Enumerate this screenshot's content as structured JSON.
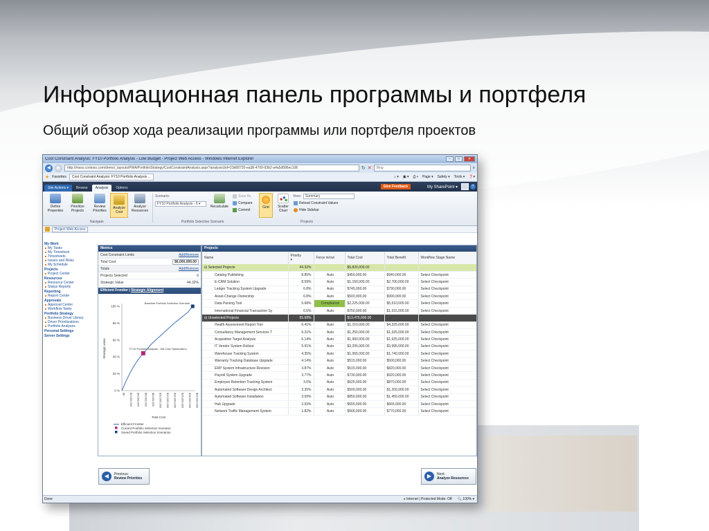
{
  "slide": {
    "title": "Информационная панель программы  и портфеля",
    "subtitle": "Общий обзор хода реализации программы или портфеля проектов"
  },
  "browser": {
    "title": "Cost Constraint Analysis: FY10 Portfolio Analysis - Low Budget - Project Web Access - Windows Internet Explorer",
    "url": "http://msss.contoso.com/demo/_layouts/PWA/PortfolioStrategy/CostConstraintAnalysis.aspx?analysisUid=23d68720-ea38-4709-93b2-a4a5d586ec106",
    "search_placeholder": "Bing",
    "favorites_label": "Favorites",
    "fav_tab": "Cost Constraint Analysis: FY10 Portfolio Analysis ...",
    "tool_page": "Page ▾",
    "tool_safety": "Safety ▾",
    "tool_tools": "Tools ▾",
    "status_left": "Done",
    "status_zone": "Internet | Protected Mode: Off",
    "zoom": "100%"
  },
  "ribbon": {
    "tabs": [
      "Site Actions ▾",
      "Browse",
      "Analysis",
      "Options"
    ],
    "give_feedback": "Give Feedback",
    "user": "My SharePoint ▾",
    "buttons": {
      "define": "Define Properties",
      "prioritize": "Prioritize Projects",
      "review": "Review Priorities",
      "analyze_cost": "Analyze Cost",
      "analyze_res": "Analyze Resources",
      "recalculate": "Recalculate",
      "save_as": "Save As",
      "compare": "Compare",
      "commit": "Commit",
      "grid": "Grid",
      "scatter": "Scatter Chart",
      "reload": "Reload Constraint Values",
      "hide_sidebar": "Hide Sidebar"
    },
    "scenario_label": "Scenario:",
    "scenario_value": "FY10 Portfolio Analysis - 6 ▾",
    "view_label": "View:",
    "view_value": "Summary",
    "groups": {
      "navigate": "Navigate",
      "scenario": "Portfolio Selection Scenario",
      "projects": "Projects"
    }
  },
  "breadcrumb": {
    "link": "Project Web Access"
  },
  "leftnav": [
    {
      "h": "My Work"
    },
    {
      "i": "My Tasks"
    },
    {
      "i": "My Timesheet"
    },
    {
      "i": "Timesheets"
    },
    {
      "i": "Issues and Risks"
    },
    {
      "i": "My Schedule"
    },
    {
      "h": "Projects"
    },
    {
      "i": "Project Center"
    },
    {
      "h": "Resources"
    },
    {
      "i": "Resource Center"
    },
    {
      "i": "Status Reports"
    },
    {
      "h": "Reporting"
    },
    {
      "i": "Report Center"
    },
    {
      "h": "Approvals"
    },
    {
      "i": "Approval Center"
    },
    {
      "i": "Workflow Tasks"
    },
    {
      "h": "Portfolio Strategy"
    },
    {
      "i": "Business Driver Library"
    },
    {
      "i": "Driver Prioritizations"
    },
    {
      "i": "Portfolio Analyses"
    },
    {
      "h": "Personal Settings"
    },
    {
      "h": "Server Settings"
    }
  ],
  "metrics": {
    "header": "Metrics",
    "cost_limits": "Cost Constraint Limits",
    "add_remove": "Add/Remove",
    "total_cost_label": "Total Cost",
    "total_cost_value": "$6,000,000.00",
    "totals": "Totals",
    "projects_selected_label": "Projects Selected",
    "projects_selected_value": "6",
    "strategic_value_label": "Strategic Value",
    "strategic_value_value": "44.32%",
    "ef_title": "Efficient Frontier",
    "ef_link": "Strategic Alignment"
  },
  "chart_data": {
    "type": "line",
    "ylabel": "Strategic value",
    "xlabel": "Total Cost",
    "y_ticks": [
      "100 %",
      "80 %",
      "60 %",
      "40 %",
      "20 %",
      "0 %"
    ],
    "x_ticks": [
      "$0",
      "$2,000,000",
      "$4,000,000",
      "$6,000,000",
      "$8,000,000",
      "$10,000,000",
      "$12,000,000",
      "$14,000,000",
      "$16,000,000",
      "$18,000,000",
      "$20,000,000"
    ],
    "annotations": {
      "baseline": "Baseline Portfolio Selection Scenario",
      "current": "FY10 Portfolio Analysis - 6M Cost Optimization"
    },
    "series": [
      {
        "name": "Efficient Frontier",
        "color": "#3f6fb4",
        "x": [
          0,
          1000000,
          2000000,
          3000000,
          4000000,
          5000000,
          6000000,
          8000000,
          10000000,
          12000000,
          14000000,
          16000000,
          18000000,
          19300000
        ],
        "y": [
          0,
          10,
          19,
          27,
          34,
          40,
          45,
          55,
          63,
          71,
          79,
          86,
          93,
          100
        ]
      },
      {
        "name": "Current Portfolio Selection Scenario",
        "color": "#b0287a",
        "x": [
          5820000
        ],
        "y": [
          44.32
        ]
      },
      {
        "name": "Saved Portfolio Selection Scenarios",
        "color": "#1d3f7a",
        "x": [
          19300000
        ],
        "y": [
          100
        ]
      }
    ],
    "ylim": [
      0,
      100
    ],
    "xlim": [
      0,
      20000000
    ]
  },
  "projects": {
    "header": "Projects",
    "columns": [
      "Name",
      "Priority",
      "Force in/out",
      "Total Cost",
      "Total Benefit",
      "Workflow Stage Name"
    ],
    "selected": {
      "label": "Selected Projects",
      "priority": "44.32%",
      "cost": "$5,820,000.00"
    },
    "selected_rows": [
      [
        "Catalog Publishing",
        "8.85%",
        "Auto",
        "$450,000.00",
        "$940,000.00",
        "Select Checkpoint"
      ],
      [
        "E-CRM Solution",
        "8.59%",
        "Auto",
        "$1,150,000.00",
        "$2,700,000.00",
        "Select Checkpoint"
      ],
      [
        "Ledger Tracking System Upgrade",
        "6.8%",
        "Auto",
        "$745,000.00",
        "$790,000.00",
        "Select Checkpoint"
      ],
      [
        "Asset-Change Ownership",
        "6.8%",
        "Auto",
        "$500,000.00",
        "$990,000.00",
        "Select Checkpoint"
      ],
      [
        "Data Parsing Tool",
        "6.68%",
        "Compliance",
        "$2,225,000.00",
        "$5,510,000.00",
        "Select Checkpoint"
      ],
      [
        "International Financial Transaction Sy",
        "6.6%",
        "Auto",
        "$750,000.00",
        "$1,315,000.00",
        "Select Checkpoint"
      ]
    ],
    "unselected": {
      "label": "Unselected Projects",
      "priority": "55.68%",
      "cost": "$13,476,000.00"
    },
    "unselected_rows": [
      [
        "Health Assessment Report Tool",
        "6.41%",
        "Auto",
        "$1,210,000.00",
        "$4,325,000.00",
        "Select Checkpoint"
      ],
      [
        "Consultancy Management Services T",
        "6.31%",
        "Auto",
        "$1,250,000.00",
        "$1,325,000.00",
        "Select Checkpoint"
      ],
      [
        "Acquisition Target Analysis",
        "6.14%",
        "Auto",
        "$1,990,000.00",
        "$1,925,000.00",
        "Select Checkpoint"
      ],
      [
        "IT Vendor System Rollout",
        "5.91%",
        "Auto",
        "$3,205,000.00",
        "$3,995,000.00",
        "Select Checkpoint"
      ],
      [
        "Warehouse Tracking System",
        "4.35%",
        "Auto",
        "$1,065,000.00",
        "$1,740,000.00",
        "Select Checkpoint"
      ],
      [
        "Warranty Tracking Database Upgrade",
        "4.14%",
        "Auto",
        "$515,000.00",
        "$500,000.00",
        "Select Checkpoint"
      ],
      [
        "ERP System Infrastructure Revision",
        "3.87%",
        "Auto",
        "$515,000.00",
        "$820,000.00",
        "Select Checkpoint"
      ],
      [
        "Payroll System Upgrade",
        "3.77%",
        "Auto",
        "$730,000.00",
        "$920,000.00",
        "Select Checkpoint"
      ],
      [
        "Employee Retention Tracking System",
        "3.6%",
        "Auto",
        "$525,000.00",
        "$870,000.00",
        "Select Checkpoint"
      ],
      [
        "Automated Software Design Architect",
        "3.35%",
        "Auto",
        "$500,000.00",
        "$1,200,000.00",
        "Select Checkpoint"
      ],
      [
        "Automated Software Installation",
        "3.09%",
        "Auto",
        "$850,000.00",
        "$1,450,000.00",
        "Select Checkpoint"
      ],
      [
        "Hub Upgrade",
        "2.93%",
        "Auto",
        "$555,000.00",
        "$665,000.00",
        "Select Checkpoint"
      ],
      [
        "Network Traffic Management System",
        "1.82%",
        "Auto",
        "$566,000.00",
        "$770,000.00",
        "Select Checkpoint"
      ]
    ]
  },
  "footer": {
    "prev_label": "Previous:",
    "prev_target": "Review Priorities",
    "next_label": "Next:",
    "next_target": "Analyze Resources"
  }
}
